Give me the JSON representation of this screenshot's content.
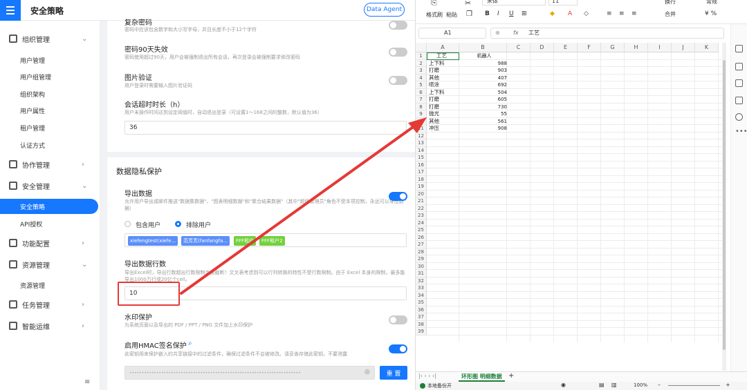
{
  "app": {
    "title": "安全策略",
    "data_agent_label": "Data Agent"
  },
  "sidebar": {
    "groups": [
      {
        "label": "组织管理",
        "chevron": "⌄"
      },
      {
        "label": "协作管理",
        "chevron": "›"
      },
      {
        "label": "安全管理",
        "chevron": "⌄"
      },
      {
        "label": "功能配置",
        "chevron": "›"
      },
      {
        "label": "资源管理",
        "chevron": "⌄"
      },
      {
        "label": "任务管理",
        "chevron": "›"
      },
      {
        "label": "智能运维",
        "chevron": "›"
      }
    ],
    "org_items": [
      "用户管理",
      "用户组管理",
      "组织架构",
      "用户属性",
      "租户管理",
      "认证方式"
    ],
    "security_items": [
      "安全策略",
      "API授权"
    ],
    "resource_items": [
      "资源管理"
    ],
    "collapse_icon": "≡"
  },
  "settings": {
    "cut_title": "复杂密码",
    "cut_desc": "密码中应该包含数字和大小写字母，并且长度不小于12个字符",
    "pwd90_title": "密码90天失效",
    "pwd90_desc": "密码使用超过90天，用户会被强制退出所有会话，再次登录会被强制要求修改密码",
    "captcha_title": "图片验证",
    "captcha_desc": "用户登录时需要输入图片验证码",
    "timeout_title": "会话超时时长（h）",
    "timeout_desc": "用户未操作时间达到设定阈值时，自动退出登录（可设置1～168之间的整数，默认值为36）",
    "timeout_value": "36"
  },
  "privacy": {
    "section_title": "数据隐私保护",
    "export_title": "导出数据",
    "export_desc": "允许用户导出或邮件推送\"数据集数据\"、\"图表明细数据\"和\"聚合结果数据\"（其中\"超级管理员\"角色不受本项控制，永远可以导出数据）",
    "radio_include": "包含用户",
    "radio_exclude": "排除用户",
    "tags": [
      "xiefengtest(xiefe...",
      "范芳芳(fanfangfa...",
      "FFF租户",
      "FFF租户2"
    ],
    "rows_title": "导出数据行数",
    "rows_desc": "导出Excel时，导出行数超出行数限制会被截断！文叉表考虑到可以行列转换的特性不受行数限制。由于 Excel 本身的限制，最多能导出1000万行或20亿个cell。",
    "rows_value": "10",
    "watermark_title": "水印保护",
    "watermark_desc": "为系统页面以及导出的 PDF / PPT / PNG 文件加上水印保护",
    "hmac_title": "启用HMAC签名保护",
    "hmac_desc": "此密钥用来保护嵌入的共享链接中的过滤条件，确保过滤条件不会被修改。请妥善存储此密钥，不要泄露",
    "secret_mask": "••••••••••••••••••••••••••••••••••••••••••••••••••••••••••••••••••••••",
    "reset_label": "重 置"
  },
  "spreadsheet": {
    "toolbar": {
      "format_painter": "格式刷",
      "paste": "粘贴",
      "font": "宋体",
      "size": "11",
      "wrap": "换行",
      "merge": "合并",
      "number_format": "常规",
      "cut_glyph": "✂"
    },
    "cell_ref": "A1",
    "fx_label": "fx",
    "formula_value": "工艺",
    "columns": [
      "A",
      "B",
      "C",
      "D",
      "E",
      "F",
      "G",
      "H",
      "I",
      "J",
      "K"
    ],
    "header_row": [
      "工艺",
      "机器人"
    ],
    "rows": [
      [
        "上下料",
        "988"
      ],
      [
        "打磨",
        "903"
      ],
      [
        "其他",
        "407"
      ],
      [
        "喷涂",
        "692"
      ],
      [
        "上下料",
        "504"
      ],
      [
        "打磨",
        "605"
      ],
      [
        "打磨",
        "730"
      ],
      [
        "抛光",
        "55"
      ],
      [
        "其他",
        "561"
      ],
      [
        "冲压",
        "908"
      ]
    ],
    "row_numbers": [
      "1",
      "2",
      "3",
      "4",
      "5",
      "6",
      "7",
      "8",
      "9",
      "10",
      "11",
      "12",
      "13",
      "14",
      "15",
      "16",
      "17",
      "18",
      "19",
      "20",
      "21",
      "22",
      "23",
      "24",
      "25",
      "26",
      "27",
      "28",
      "29",
      "30",
      "31",
      "32",
      "33",
      "34",
      "35",
      "36",
      "37",
      "38",
      "39"
    ],
    "sheet_tab": "环形图 明细数据",
    "add_sheet": "+",
    "status_left": "本地备份开",
    "zoom": "100%"
  }
}
